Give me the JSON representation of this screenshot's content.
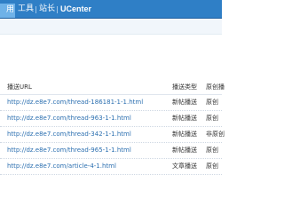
{
  "topnav": {
    "active_tab": "用",
    "items": [
      "工具",
      "站长",
      "UCenter"
    ]
  },
  "table": {
    "headers": {
      "url": "播送URL",
      "type": "播送类型",
      "status": "原创播"
    },
    "rows": [
      {
        "url": "http://dz.e8e7.com/thread-186181-1-1.html",
        "type": "新帖播送",
        "status": "原创"
      },
      {
        "url": "http://dz.e8e7.com/thread-963-1-1.html",
        "type": "新帖播送",
        "status": "原创"
      },
      {
        "url": "http://dz.e8e7.com/thread-342-1-1.html",
        "type": "新帖播送",
        "status": "非原创"
      },
      {
        "url": "http://dz.e8e7.com/thread-965-1-1.html",
        "type": "新帖播送",
        "status": "原创"
      },
      {
        "url": "http://dz.e8e7.com/article-4-1.html",
        "type": "文章播送",
        "status": "原创"
      }
    ]
  },
  "colors": {
    "topbar": "#2f7fc6",
    "active_tab": "#6fb2e8",
    "link": "#2b6fb0"
  }
}
